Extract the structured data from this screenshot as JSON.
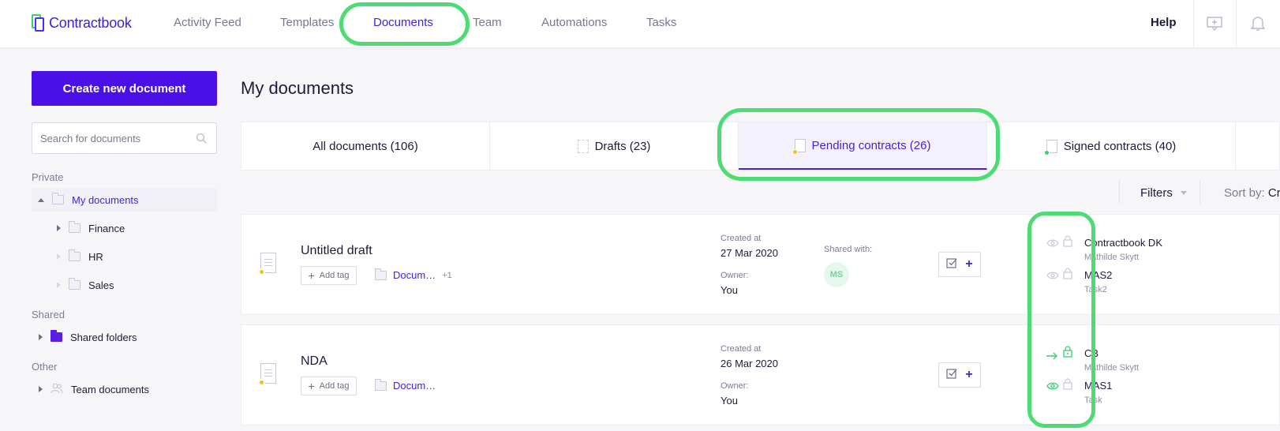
{
  "brand": {
    "name": "Contractbook"
  },
  "nav": {
    "items": [
      {
        "label": "Activity Feed",
        "active": false
      },
      {
        "label": "Templates",
        "active": false
      },
      {
        "label": "Documents",
        "active": true
      },
      {
        "label": "Team",
        "active": false
      },
      {
        "label": "Automations",
        "active": false
      },
      {
        "label": "Tasks",
        "active": false
      }
    ],
    "help": "Help"
  },
  "sidebar": {
    "create_button": "Create new document",
    "search_placeholder": "Search for documents",
    "sections": {
      "private": "Private",
      "shared": "Shared",
      "other": "Other"
    },
    "private_items": [
      {
        "label": "My documents",
        "selected": true
      },
      {
        "label": "Finance"
      },
      {
        "label": "HR"
      },
      {
        "label": "Sales"
      }
    ],
    "shared_items": [
      {
        "label": "Shared folders"
      }
    ],
    "other_items": [
      {
        "label": "Team documents"
      }
    ]
  },
  "main": {
    "title": "My documents",
    "tabs": [
      {
        "label": "All documents (106)"
      },
      {
        "label": "Drafts (23)"
      },
      {
        "label": "Pending contracts (26)",
        "active": true
      },
      {
        "label": "Signed contracts (40)"
      }
    ],
    "filters_label": "Filters",
    "sort_label": "Sort by:",
    "sort_value": "Cr"
  },
  "labels": {
    "add_tag": "Add tag",
    "created_at": "Created at",
    "owner": "Owner:",
    "shared_with": "Shared with:"
  },
  "documents": [
    {
      "title": "Untitled draft",
      "folder": "Docum…",
      "folder_extra": "+1",
      "created": "27 Mar 2020",
      "owner": "You",
      "shared_initials": "MS",
      "signers": [
        {
          "name": "Contractbook DK",
          "sub": "Mathilde Skytt"
        },
        {
          "name": "MAS2",
          "sub": "Task2"
        }
      ]
    },
    {
      "title": "NDA",
      "folder": "Docum…",
      "folder_extra": "",
      "created": "26 Mar 2020",
      "owner": "You",
      "shared_initials": "",
      "signers": [
        {
          "name": "CB",
          "sub": "Mathilde Skytt"
        },
        {
          "name": "MAS1",
          "sub": "Task"
        }
      ]
    }
  ],
  "colors": {
    "accent": "#4a10e6",
    "highlight": "#4ddc74",
    "pending_dot": "#f4c21a",
    "signed_dot": "#3ccf6e"
  }
}
